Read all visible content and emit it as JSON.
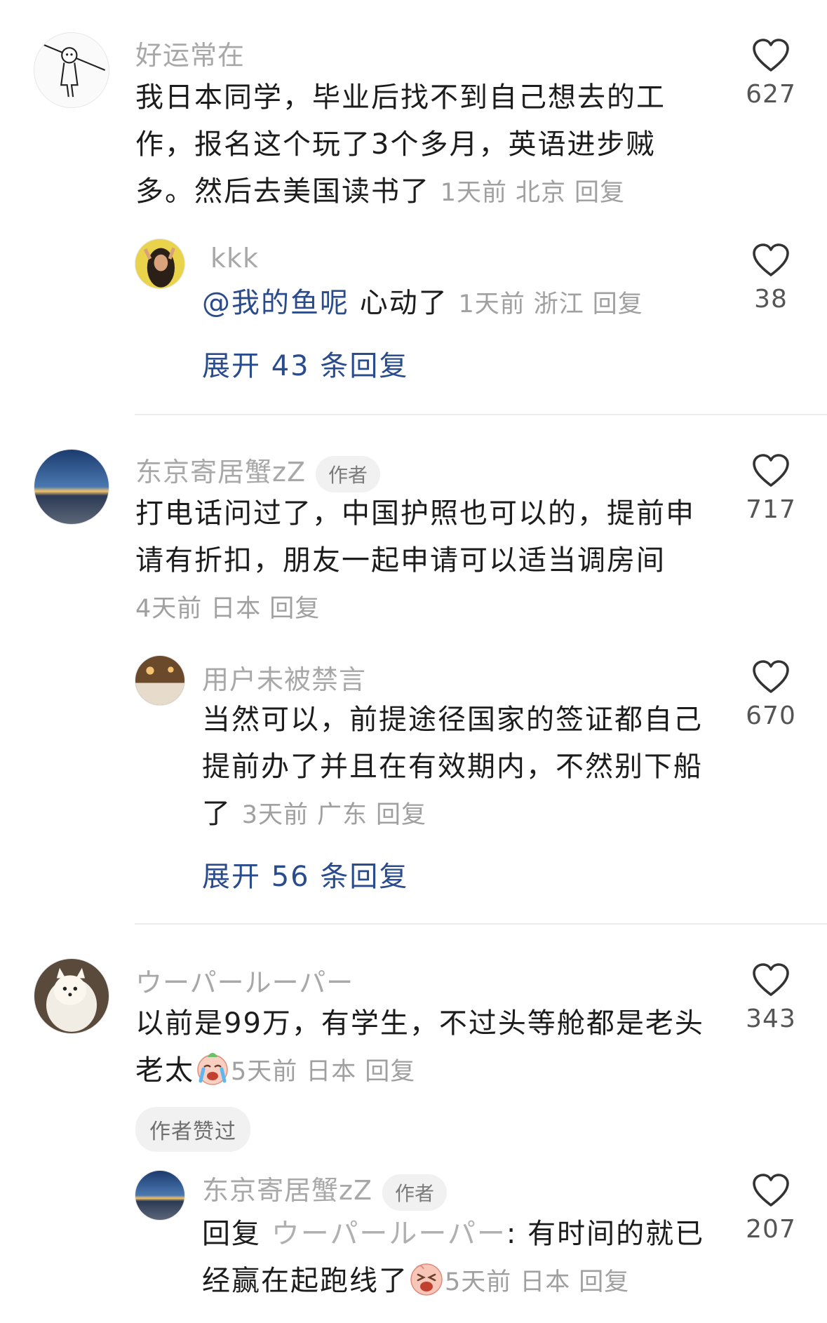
{
  "comments": [
    {
      "user": "好运常在",
      "text": "我日本同学，毕业后找不到自己想去的工作，报名这个玩了3个多月，英语进步贼多。然后去美国读书了",
      "time": "1天前",
      "location": "北京",
      "reply_label": "回复",
      "likes": "627"
    },
    {
      "user": "kkk",
      "mention": "@我的鱼呢",
      "text": " 心动了",
      "time": "1天前",
      "location": "浙江",
      "reply_label": "回复",
      "likes": "38"
    },
    {
      "expand_label": "展开 43 条回复"
    },
    {
      "user": "东京寄居蟹zZ",
      "badge": "作者",
      "text": "打电话问过了，中国护照也可以的，提前申请有折扣，朋友一起申请可以适当调房间",
      "time": "4天前",
      "location": "日本",
      "reply_label": "回复",
      "likes": "717"
    },
    {
      "user": "用户未被禁言",
      "text": "当然可以，前提途径国家的签证都自己提前办了并且在有效期内，不然别下船了",
      "time": "3天前",
      "location": "广东",
      "reply_label": "回复",
      "likes": "670"
    },
    {
      "expand_label": "展开 56 条回复"
    },
    {
      "user": "ウーパールーパー",
      "text": "以前是99万，有学生，不过头等舱都是老头老太",
      "time": "5天前",
      "location": "日本",
      "reply_label": "回复",
      "likes": "343",
      "tag": "作者赞过",
      "emoji": "crying-face-emoji"
    },
    {
      "user": "东京寄居蟹zZ",
      "badge": "作者",
      "reply_prefix": "回复 ",
      "reply_target": "ウーパールーパー",
      "reply_colon": ": ",
      "text": "有时间的就已经赢在起跑线了",
      "time": "5天前",
      "location": "日本",
      "reply_label": "回复",
      "likes": "207",
      "emoji": "weary-face-emoji"
    }
  ],
  "colors": {
    "link": "#2a4c8c",
    "username": "#a8a8a8",
    "meta": "#a0a0a0",
    "divider": "#ececec"
  },
  "icons": {
    "like": "heart-outline-icon"
  }
}
